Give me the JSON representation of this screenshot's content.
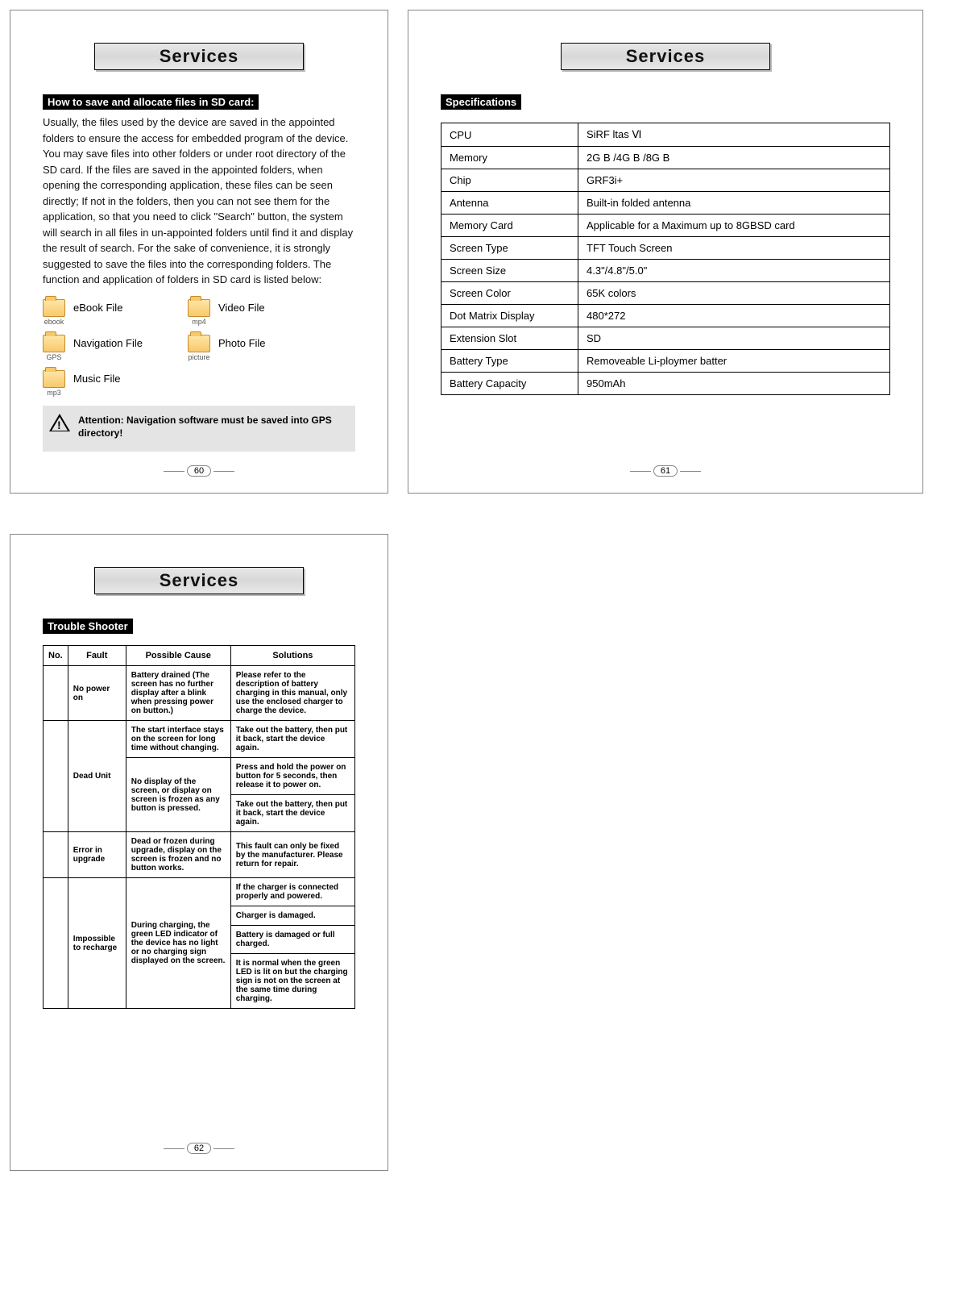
{
  "page60": {
    "banner": "Services",
    "heading": "How to save and allocate files in SD card:",
    "body": "Usually, the files used by the device are saved in the appointed folders to ensure the access for embedded program of the device. You may save files into other folders or under root directory of the SD card. If the files are saved in the appointed folders, when opening the corresponding application, these files can be seen directly; If not in the folders, then you can not see them for the application, so that you need to click \"Search\" button, the system will search in all files in un-appointed folders until find it and display the result of search. For the sake of convenience, it is strongly suggested to save the files into the corresponding folders.  The function and application of folders in SD card is listed below:",
    "folders": [
      {
        "caption": "ebook",
        "label": "eBook File"
      },
      {
        "caption": "mp4",
        "label": "Video File"
      },
      {
        "caption": "GPS",
        "label": "Navigation File"
      },
      {
        "caption": "picture",
        "label": "Photo File"
      },
      {
        "caption": "mp3",
        "label": "Music File"
      }
    ],
    "attention_label": "Attention:",
    "attention_text": "Navigation software must be saved into GPS directory!",
    "pagenum": "60"
  },
  "page61": {
    "banner": "Services",
    "heading": "Specifications",
    "specs": [
      {
        "k": "CPU",
        "v": "SiRF  ltas  Ⅵ"
      },
      {
        "k": "Memory",
        "v": "2G B /4G B /8G B"
      },
      {
        "k": "Chip",
        "v": "GRF3i+"
      },
      {
        "k": "Antenna",
        "v": "Built-in folded antenna"
      },
      {
        "k": "Memory Card",
        "v": "Applicable for a Maximum up to 8GBSD card"
      },
      {
        "k": "Screen Type",
        "v": "TFT Touch Screen"
      },
      {
        "k": "Screen Size",
        "v": "4.3\"/4.8\"/5.0\""
      },
      {
        "k": "Screen Color",
        "v": "65K colors"
      },
      {
        "k": "Dot Matrix Display",
        "v": "480*272"
      },
      {
        "k": "Extension Slot",
        "v": "SD"
      },
      {
        "k": "Battery Type",
        "v": "Removeable Li-ploymer batter"
      },
      {
        "k": "Battery Capacity",
        "v": "950mAh"
      }
    ],
    "pagenum": "61"
  },
  "page62": {
    "banner": "Services",
    "heading": "Trouble Shooter",
    "cols": {
      "no": "No.",
      "fault": "Fault",
      "cause": "Possible Cause",
      "sol": "Solutions"
    },
    "rows": [
      {
        "fault": "No power on",
        "cause": "Battery drained (The screen has no further display after a blink when pressing power on button.)",
        "sols": [
          "Please refer to the description of battery charging in this manual, only use the enclosed charger to charge the device."
        ]
      },
      {
        "fault": "Dead Unit",
        "groups": [
          {
            "cause": "The start interface stays on the screen for long time without changing.",
            "sols": [
              "Take out the battery, then put it back, start the device again."
            ]
          },
          {
            "cause": "No display of the screen, or display on screen is frozen as any button is pressed.",
            "sols": [
              "Press and hold the power on button for 5 seconds, then release it to power on.",
              "Take out the battery, then put it back, start the device again."
            ]
          }
        ]
      },
      {
        "fault": "Error in upgrade",
        "cause": "Dead or frozen during upgrade, display on the screen is frozen and no button works.",
        "sols": [
          "This fault can only be fixed by the manufacturer. Please return for repair."
        ]
      },
      {
        "fault": "Impossible to recharge",
        "cause": "During charging, the green LED indicator of the device has no light or no charging sign displayed on the screen.",
        "sols": [
          "If the charger is connected properly and powered.",
          "Charger is damaged.",
          "Battery is damaged or full charged.",
          "It is normal when the green LED is lit on but the charging sign is not on the screen at the same time during charging."
        ]
      }
    ],
    "pagenum": "62"
  }
}
